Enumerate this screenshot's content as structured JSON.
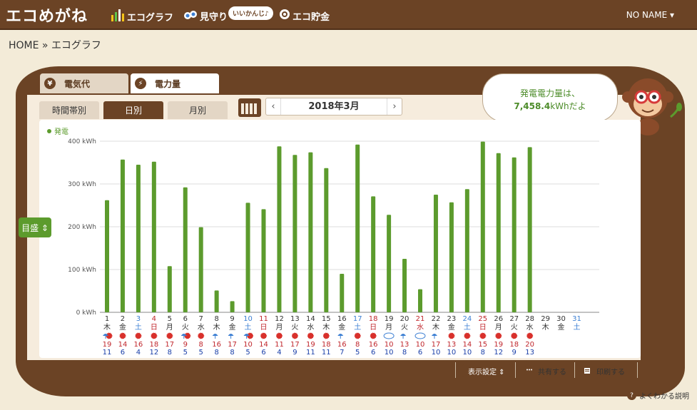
{
  "header": {
    "logo": "エコめがね",
    "nav": [
      {
        "label": "エコグラフ",
        "icon": "bar-chart-icon"
      },
      {
        "label": "見守り",
        "icon": "binoculars-icon"
      },
      {
        "label": "エコ貯金",
        "icon": "piggy-bank-icon"
      }
    ],
    "watch_bubble": "いいかんじ♪",
    "user_menu": "NO NAME ▾"
  },
  "breadcrumb": "HOME » エコグラフ",
  "tabs": {
    "main": [
      {
        "label": "電気代",
        "icon_char": "¥"
      },
      {
        "label": "電力量",
        "icon_char": "⚡"
      }
    ],
    "sub": [
      "時間帯別",
      "日別",
      "月別"
    ]
  },
  "month_nav": {
    "prev": "‹",
    "label": "2018年3月",
    "next": "›"
  },
  "bubble": {
    "line1": "発電電力量は、",
    "value": "7,458.4",
    "unit": "kWhだよ"
  },
  "scale_button": "目盛 ⇕",
  "actions": {
    "display": "表示設定 ⇕",
    "share": "共有する",
    "print": "印刷する"
  },
  "help": "よくわかる説明",
  "colors": {
    "bar": "#5c9b2d",
    "brown": "#6b4325",
    "saturday": "#3c7fd3",
    "sunday": "#c0272d",
    "hi": "#c0272d",
    "lo": "#1a3fa8"
  },
  "chart_data": {
    "type": "bar",
    "legend": "発電",
    "y_ticks": [
      "400 kWh",
      "300 kWh",
      "200 kWh",
      "100 kWh",
      "0 kWh"
    ],
    "ylim": [
      0,
      400
    ],
    "days": [
      "1",
      "2",
      "3",
      "4",
      "5",
      "6",
      "7",
      "8",
      "9",
      "10",
      "11",
      "12",
      "13",
      "14",
      "15",
      "16",
      "17",
      "18",
      "19",
      "20",
      "21",
      "22",
      "23",
      "24",
      "25",
      "26",
      "27",
      "28",
      "29",
      "30",
      "31"
    ],
    "weekdays": [
      "木",
      "金",
      "土",
      "日",
      "月",
      "火",
      "水",
      "木",
      "金",
      "土",
      "日",
      "月",
      "火",
      "水",
      "木",
      "金",
      "土",
      "日",
      "月",
      "火",
      "水",
      "木",
      "金",
      "土",
      "日",
      "月",
      "火",
      "水",
      "木",
      "金",
      "土"
    ],
    "day_types": [
      "n",
      "n",
      "sat",
      "sun",
      "n",
      "n",
      "n",
      "n",
      "n",
      "sat",
      "sun",
      "n",
      "n",
      "n",
      "n",
      "n",
      "sat",
      "sun",
      "n",
      "n",
      "sun",
      "n",
      "n",
      "sat",
      "sun",
      "n",
      "n",
      "n",
      "n",
      "n",
      "sat"
    ],
    "values": [
      262,
      357,
      345,
      352,
      108,
      292,
      199,
      51,
      26,
      256,
      241,
      388,
      368,
      374,
      337,
      90,
      392,
      271,
      228,
      125,
      54,
      275,
      257,
      288,
      399,
      372,
      362,
      386,
      null,
      null,
      null
    ],
    "weather": [
      "sun-rain",
      "sun",
      "sun",
      "sun",
      "sun",
      "sun-rain",
      "sun",
      "rain",
      "rain",
      "sun-rain",
      "sun",
      "sun",
      "sun",
      "sun",
      "sun",
      "rain",
      "sun",
      "sun",
      "cloud",
      "rain",
      "cloud",
      "rain",
      "sun",
      "sun",
      "sun",
      "sun",
      "sun",
      "sun",
      null,
      null,
      null
    ],
    "temp_high": [
      "19",
      "14",
      "16",
      "18",
      "17",
      "9",
      "8",
      "16",
      "17",
      "10",
      "14",
      "11",
      "17",
      "19",
      "18",
      "16",
      "8",
      "16",
      "10",
      "13",
      "10",
      "17",
      "13",
      "14",
      "15",
      "19",
      "18",
      "20",
      null,
      null,
      null
    ],
    "temp_low": [
      "11",
      "6",
      "4",
      "12",
      "8",
      "5",
      "5",
      "8",
      "8",
      "5",
      "6",
      "4",
      "9",
      "11",
      "11",
      "7",
      "5",
      "6",
      "10",
      "8",
      "6",
      "10",
      "10",
      "10",
      "8",
      "12",
      "9",
      "13",
      null,
      null,
      null
    ]
  }
}
